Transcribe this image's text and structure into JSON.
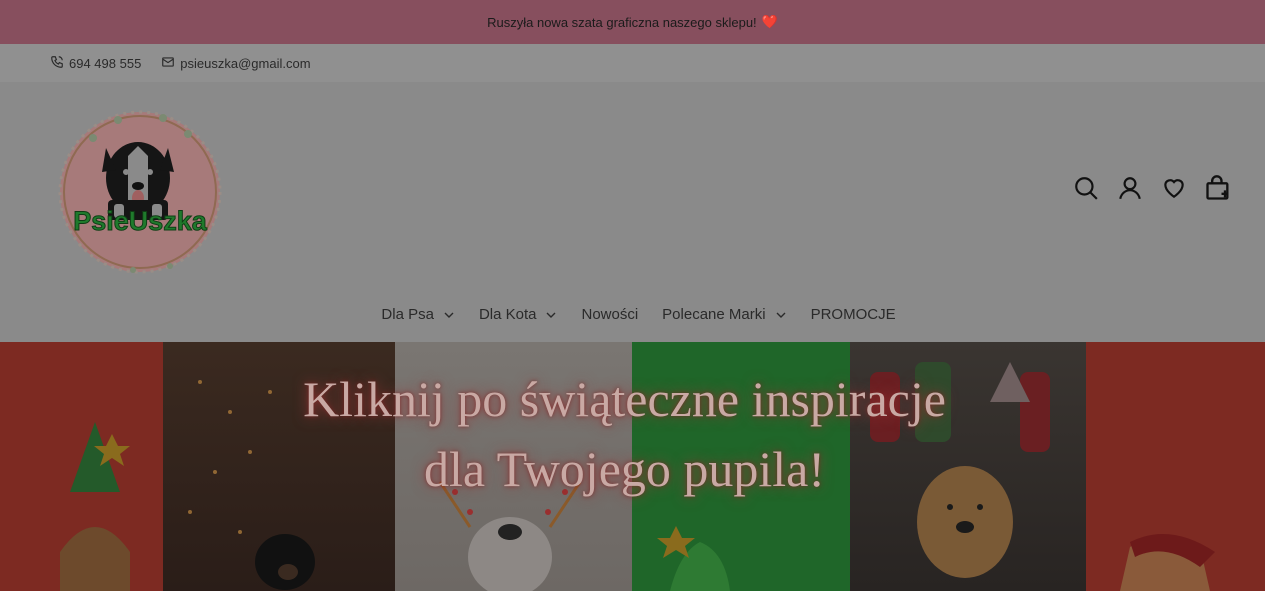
{
  "announcement": {
    "text": "Ruszyła nowa szata graficzna naszego sklepu!",
    "heart": "❤️"
  },
  "contact": {
    "phone": "694 498 555",
    "email": "psieuszka@gmail.com"
  },
  "logo": {
    "text": "PsieUszka"
  },
  "header_icons": [
    "search-icon",
    "account-icon",
    "wishlist-heart-icon",
    "cart-bag-icon"
  ],
  "nav": [
    {
      "label": "Dla Psa",
      "dropdown": true
    },
    {
      "label": "Dla Kota",
      "dropdown": true
    },
    {
      "label": "Nowości",
      "dropdown": false
    },
    {
      "label": "Polecane Marki",
      "dropdown": true
    },
    {
      "label": "PROMOCJE",
      "dropdown": false
    }
  ],
  "hero": {
    "line1": "Kliknij po świąteczne inspiracje",
    "line2": "dla Twojego pupila!"
  },
  "colors": {
    "announcement_bg": "#874f5e",
    "overlay_gray": "#8a8a8a",
    "hero_red": "#7f2b22",
    "logo_green": "#1f7a2c"
  }
}
